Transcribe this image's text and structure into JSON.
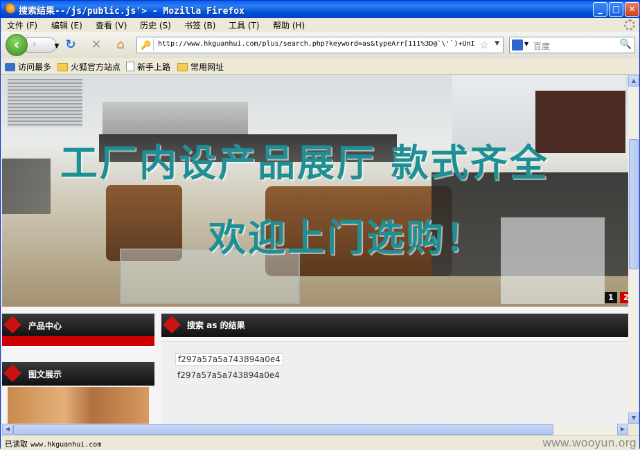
{
  "window": {
    "title": "搜索结果--/js/public.js'> - Mozilla Firefox",
    "min_glyph": "_",
    "max_glyph": "□",
    "close_glyph": "✕"
  },
  "menu": [
    "文件 (F)",
    "编辑 (E)",
    "查看 (V)",
    "历史 (S)",
    "书签 (B)",
    "工具 (T)",
    "帮助 (H)"
  ],
  "nav": {
    "back_glyph": "‹",
    "forward_glyph": "›",
    "reload_glyph": "↻",
    "stop_glyph": "✕",
    "home_glyph": "⌂",
    "url": "http://www.hkguanhui.com/plus/search.php?keyword=as&typeArr[111%3D@`\\'`)+UnI",
    "search_placeholder": "百度"
  },
  "bookmarks": [
    {
      "label": "访问最多",
      "icon": "most-visited-icon"
    },
    {
      "label": "火狐官方站点",
      "icon": "folder-icon"
    },
    {
      "label": "新手上路",
      "icon": "page-icon"
    },
    {
      "label": "常用网址",
      "icon": "folder-icon"
    }
  ],
  "banner": {
    "line1": "工厂内设产品展厅 款式齐全",
    "line2": "欢迎上门选购！",
    "slides": [
      "1",
      "2"
    ]
  },
  "sidebar": {
    "panel1_title": "产品中心",
    "panel2_title": "图文展示"
  },
  "main": {
    "heading": "搜索 as 的结果",
    "results": [
      "f297a57a5a743894a0e4",
      "f297a57a5a743894a0e4"
    ]
  },
  "status": {
    "text": "已读取",
    "url": "www.hkguanhui.com",
    "watermark": "www.wooyun.org"
  },
  "colors": {
    "title_blue": "#0050d8",
    "banner_text": "#1f8f96",
    "accent_red": "#cc1111"
  }
}
